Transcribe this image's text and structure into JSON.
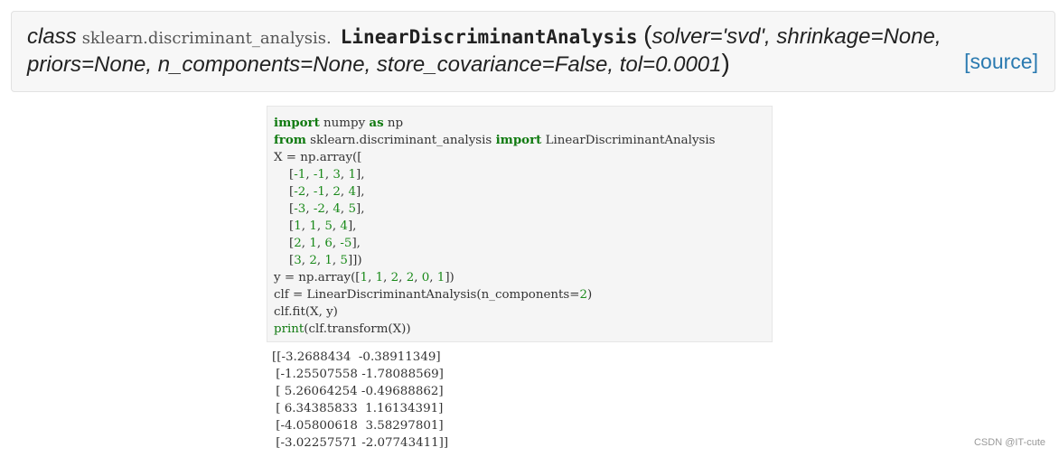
{
  "signature": {
    "keyword": "class",
    "module_path": "sklearn.discriminant_analysis.",
    "class_name": "LinearDiscriminantAnalysis",
    "open_paren": "(",
    "params_line1": "solver='svd', shrinkage=None,",
    "params_line2": "priors=None, n_components=None, store_covariance=False, tol=0.0001",
    "close_paren": ")",
    "source_link": "[source]"
  },
  "code": {
    "lines": [
      [
        {
          "t": "import",
          "c": "kw"
        },
        {
          "t": " numpy ",
          "c": ""
        },
        {
          "t": "as",
          "c": "kw"
        },
        {
          "t": " np",
          "c": ""
        }
      ],
      [
        {
          "t": "from",
          "c": "kw"
        },
        {
          "t": " sklearn.discriminant_analysis ",
          "c": ""
        },
        {
          "t": "import",
          "c": "kw"
        },
        {
          "t": " LinearDiscriminantAnalysis",
          "c": ""
        }
      ],
      [
        {
          "t": "X = np.array([",
          "c": ""
        }
      ],
      [
        {
          "t": "    [",
          "c": ""
        },
        {
          "t": "-1",
          "c": "num"
        },
        {
          "t": ", ",
          "c": ""
        },
        {
          "t": "-1",
          "c": "num"
        },
        {
          "t": ", ",
          "c": ""
        },
        {
          "t": "3",
          "c": "num"
        },
        {
          "t": ", ",
          "c": ""
        },
        {
          "t": "1",
          "c": "num"
        },
        {
          "t": "],",
          "c": ""
        }
      ],
      [
        {
          "t": "    [",
          "c": ""
        },
        {
          "t": "-2",
          "c": "num"
        },
        {
          "t": ", ",
          "c": ""
        },
        {
          "t": "-1",
          "c": "num"
        },
        {
          "t": ", ",
          "c": ""
        },
        {
          "t": "2",
          "c": "num"
        },
        {
          "t": ", ",
          "c": ""
        },
        {
          "t": "4",
          "c": "num"
        },
        {
          "t": "],",
          "c": ""
        }
      ],
      [
        {
          "t": "    [",
          "c": ""
        },
        {
          "t": "-3",
          "c": "num"
        },
        {
          "t": ", ",
          "c": ""
        },
        {
          "t": "-2",
          "c": "num"
        },
        {
          "t": ", ",
          "c": ""
        },
        {
          "t": "4",
          "c": "num"
        },
        {
          "t": ", ",
          "c": ""
        },
        {
          "t": "5",
          "c": "num"
        },
        {
          "t": "],",
          "c": ""
        }
      ],
      [
        {
          "t": "    [",
          "c": ""
        },
        {
          "t": "1",
          "c": "num"
        },
        {
          "t": ", ",
          "c": ""
        },
        {
          "t": "1",
          "c": "num"
        },
        {
          "t": ", ",
          "c": ""
        },
        {
          "t": "5",
          "c": "num"
        },
        {
          "t": ", ",
          "c": ""
        },
        {
          "t": "4",
          "c": "num"
        },
        {
          "t": "],",
          "c": ""
        }
      ],
      [
        {
          "t": "    [",
          "c": ""
        },
        {
          "t": "2",
          "c": "num"
        },
        {
          "t": ", ",
          "c": ""
        },
        {
          "t": "1",
          "c": "num"
        },
        {
          "t": ", ",
          "c": ""
        },
        {
          "t": "6",
          "c": "num"
        },
        {
          "t": ", ",
          "c": ""
        },
        {
          "t": "-5",
          "c": "num"
        },
        {
          "t": "],",
          "c": ""
        }
      ],
      [
        {
          "t": "    [",
          "c": ""
        },
        {
          "t": "3",
          "c": "num"
        },
        {
          "t": ", ",
          "c": ""
        },
        {
          "t": "2",
          "c": "num"
        },
        {
          "t": ", ",
          "c": ""
        },
        {
          "t": "1",
          "c": "num"
        },
        {
          "t": ", ",
          "c": ""
        },
        {
          "t": "5",
          "c": "num"
        },
        {
          "t": "]])",
          "c": ""
        }
      ],
      [
        {
          "t": "y = np.array([",
          "c": ""
        },
        {
          "t": "1",
          "c": "num"
        },
        {
          "t": ", ",
          "c": ""
        },
        {
          "t": "1",
          "c": "num"
        },
        {
          "t": ", ",
          "c": ""
        },
        {
          "t": "2",
          "c": "num"
        },
        {
          "t": ", ",
          "c": ""
        },
        {
          "t": "2",
          "c": "num"
        },
        {
          "t": ", ",
          "c": ""
        },
        {
          "t": "0",
          "c": "num"
        },
        {
          "t": ", ",
          "c": ""
        },
        {
          "t": "1",
          "c": "num"
        },
        {
          "t": "])",
          "c": ""
        }
      ],
      [
        {
          "t": "clf = LinearDiscriminantAnalysis(n_components=",
          "c": ""
        },
        {
          "t": "2",
          "c": "num"
        },
        {
          "t": ")",
          "c": ""
        }
      ],
      [
        {
          "t": "clf.fit(X, y)",
          "c": ""
        }
      ],
      [
        {
          "t": "print",
          "c": "builtin"
        },
        {
          "t": "(clf.transform(X))",
          "c": ""
        }
      ]
    ]
  },
  "output": {
    "lines": [
      "[[-3.2688434  -0.38911349]",
      " [-1.25507558 -1.78088569]",
      " [ 5.26064254 -0.49688862]",
      " [ 6.34385833  1.16134391]",
      " [-4.05800618  3.58297801]",
      " [-3.02257571 -2.07743411]]"
    ]
  },
  "watermark": "CSDN @IT-cute"
}
